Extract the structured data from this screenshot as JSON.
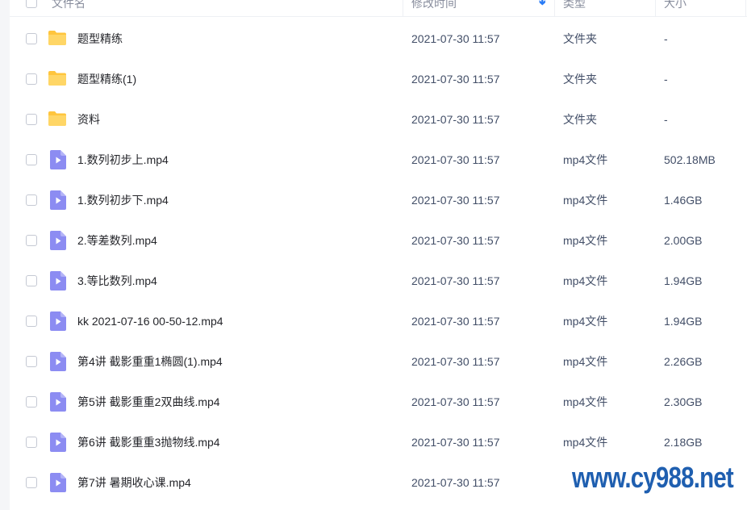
{
  "header": {
    "name_label": "文件名",
    "time_label": "修改时间",
    "type_label": "类型",
    "size_label": "大小",
    "sort_icon": "arrow-down-icon"
  },
  "rows": [
    {
      "kind": "folder",
      "name": "题型精练",
      "time": "2021-07-30 11:57",
      "type": "文件夹",
      "size": "-"
    },
    {
      "kind": "folder",
      "name": "题型精练(1)",
      "time": "2021-07-30 11:57",
      "type": "文件夹",
      "size": "-"
    },
    {
      "kind": "folder",
      "name": "资料",
      "time": "2021-07-30 11:57",
      "type": "文件夹",
      "size": "-"
    },
    {
      "kind": "video",
      "name": "1.数列初步上.mp4",
      "time": "2021-07-30 11:57",
      "type": "mp4文件",
      "size": "502.18MB"
    },
    {
      "kind": "video",
      "name": "1.数列初步下.mp4",
      "time": "2021-07-30 11:57",
      "type": "mp4文件",
      "size": "1.46GB"
    },
    {
      "kind": "video",
      "name": "2.等差数列.mp4",
      "time": "2021-07-30 11:57",
      "type": "mp4文件",
      "size": "2.00GB"
    },
    {
      "kind": "video",
      "name": "3.等比数列.mp4",
      "time": "2021-07-30 11:57",
      "type": "mp4文件",
      "size": "1.94GB"
    },
    {
      "kind": "video",
      "name": "kk 2021-07-16 00-50-12.mp4",
      "time": "2021-07-30 11:57",
      "type": "mp4文件",
      "size": "1.94GB"
    },
    {
      "kind": "video",
      "name": "第4讲 截影重重1椭圆(1).mp4",
      "time": "2021-07-30 11:57",
      "type": "mp4文件",
      "size": "2.26GB"
    },
    {
      "kind": "video",
      "name": "第5讲 截影重重2双曲线.mp4",
      "time": "2021-07-30 11:57",
      "type": "mp4文件",
      "size": "2.30GB"
    },
    {
      "kind": "video",
      "name": "第6讲 截影重重3抛物线.mp4",
      "time": "2021-07-30 11:57",
      "type": "mp4文件",
      "size": "2.18GB"
    },
    {
      "kind": "video",
      "name": "第7讲 暑期收心课.mp4",
      "time": "2021-07-30 11:57",
      "type": "",
      "size": ""
    }
  ],
  "watermark": "www.cy988.net",
  "colors": {
    "folder": "#ffc53d",
    "video": "#8c8cf2",
    "accent": "#2a7cf6",
    "watermark": "#1f5fb0"
  }
}
